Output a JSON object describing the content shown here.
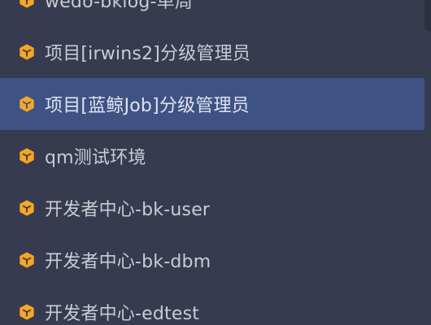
{
  "colors": {
    "background": "#363b4f",
    "selected_row": "#3e5384",
    "icon": "#f5a623",
    "text": "#c9ccd6"
  },
  "icon": "cube-icon",
  "projects": [
    {
      "label": "wedo-bklog-单周",
      "selected": false
    },
    {
      "label": "项目[irwins2]分级管理员",
      "selected": false
    },
    {
      "label": "项目[蓝鲸Job]分级管理员",
      "selected": true
    },
    {
      "label": "qm测试环境",
      "selected": false
    },
    {
      "label": "开发者中心-bk-user",
      "selected": false
    },
    {
      "label": "开发者中心-bk-dbm",
      "selected": false
    },
    {
      "label": "开发者中心-edtest",
      "selected": false
    }
  ]
}
